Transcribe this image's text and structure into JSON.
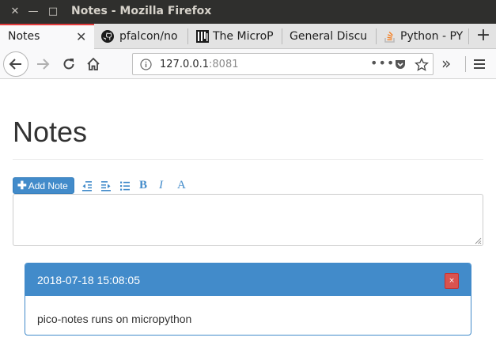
{
  "window": {
    "title": "Notes - Mozilla Firefox"
  },
  "tabs": [
    {
      "label": "Notes",
      "active": true,
      "icon": "none"
    },
    {
      "label": "pfalcon/no",
      "icon": "github-icon"
    },
    {
      "label": "The MicroP",
      "icon": "micropython-icon"
    },
    {
      "label": "General Discu",
      "icon": "none"
    },
    {
      "label": "Python - PY",
      "icon": "stackoverflow-icon"
    }
  ],
  "navbar": {
    "url_host": "127.0.0.1",
    "url_port": ":8081"
  },
  "page": {
    "heading": "Notes",
    "add_note_label": "Add Note",
    "toolbar_icons": [
      "outdent-icon",
      "indent-icon",
      "list-icon",
      "bold-icon",
      "italic-icon",
      "font-icon"
    ],
    "toolbar_glyphs": {
      "bold": "B",
      "italic": "I",
      "font": "A"
    },
    "editor_value": ""
  },
  "notes": [
    {
      "timestamp": "2018-07-18 15:08:05",
      "delete_label": "×",
      "content": "pico-notes runs on micropython"
    }
  ],
  "colors": {
    "accent": "#428bca",
    "danger": "#d9534f",
    "titlebar": "#2f2f2d",
    "active_tab_border": "#e33b3b"
  }
}
